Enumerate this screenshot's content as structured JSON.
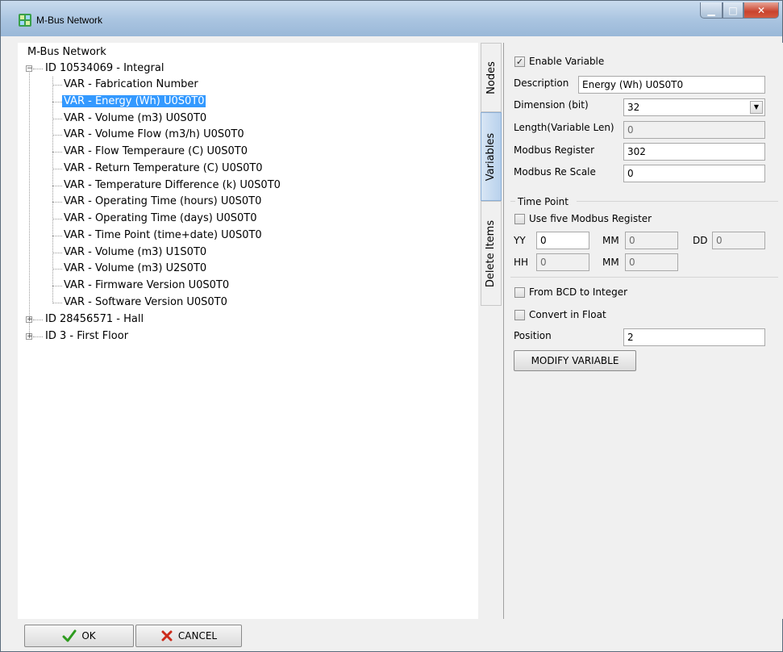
{
  "window": {
    "title": "M-Bus Network"
  },
  "tree": {
    "root": "M-Bus Network",
    "nodes": [
      {
        "label": "ID 10534069 - Integral",
        "expanded": true
      },
      {
        "label": "ID 28456571 - Hall",
        "expanded": false
      },
      {
        "label": "ID 3 - First Floor",
        "expanded": false
      }
    ],
    "vars": [
      "VAR - Fabrication Number",
      "VAR - Energy (Wh) U0S0T0",
      "VAR - Volume (m3) U0S0T0",
      "VAR - Volume Flow (m3/h) U0S0T0",
      "VAR - Flow Temperaure (C) U0S0T0",
      "VAR - Return Temperature (C) U0S0T0",
      "VAR - Temperature Difference (k) U0S0T0",
      "VAR - Operating Time (hours) U0S0T0",
      "VAR - Operating Time (days) U0S0T0",
      "VAR - Time Point (time+date) U0S0T0",
      "VAR - Volume (m3) U1S0T0",
      "VAR - Volume (m3) U2S0T0",
      "VAR - Firmware Version U0S0T0",
      "VAR - Software Version U0S0T0"
    ],
    "selected_index": 1
  },
  "tabs": {
    "nodes": "Nodes",
    "variables": "Variables",
    "delete": "Delete Items"
  },
  "form": {
    "enable_label": "Enable Variable",
    "enable_checked": true,
    "description_label": "Description",
    "description_value": "Energy (Wh) U0S0T0",
    "dimension_label": "Dimension (bit)",
    "dimension_value": "32",
    "length_label": "Length(Variable Len)",
    "length_value": "0",
    "register_label": "Modbus Register",
    "register_value": "302",
    "rescale_label": "Modbus Re Scale",
    "rescale_value": "0",
    "timepoint_title": "Time Point",
    "five_reg_label": "Use five Modbus Register",
    "yy_label": "YY",
    "yy_value": "0",
    "mm_label": "MM",
    "mm_value": "0",
    "dd_label": "DD",
    "dd_value": "0",
    "hh_label": "HH",
    "hh_value": "0",
    "min_label": "MM",
    "min_value": "0",
    "bcd_label": "From BCD to Integer",
    "float_label": "Convert in Float",
    "position_label": "Position",
    "position_value": "2",
    "modify_button": "MODIFY VARIABLE"
  },
  "bottom": {
    "ok": "OK",
    "cancel": "CANCEL"
  },
  "colors": {
    "selection": "#3399ff",
    "ok_check": "#2e9b1f",
    "cancel_x": "#cc2a1a"
  }
}
